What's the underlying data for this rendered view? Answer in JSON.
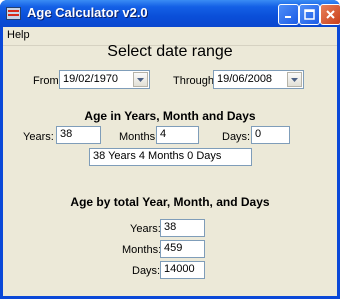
{
  "window": {
    "title": "Age Calculator v2.0"
  },
  "menu": {
    "help": "Help"
  },
  "header": {
    "title": "Select date range"
  },
  "from": {
    "label": "From:",
    "value": "19/02/1970"
  },
  "through": {
    "label": "Through:",
    "value": "19/06/2008"
  },
  "section1": {
    "title": "Age in Years, Month and Days",
    "years_label": "Years:",
    "years_value": "38",
    "months_label": "Months:",
    "months_value": "4",
    "days_label": "Days:",
    "days_value": "0",
    "summary": "38 Years 4 Months 0 Days"
  },
  "section2": {
    "title": "Age by total Year, Month, and Days",
    "years_label": "Years:",
    "years_value": "38",
    "months_label": "Months:",
    "months_value": "459",
    "days_label": "Days:",
    "days_value": "14000"
  },
  "colors": {
    "titlebar": "#0a4fd9",
    "client": "#ece9d8",
    "field_border": "#7f9db9"
  },
  "icons": [
    "app-icon",
    "minimize-icon",
    "maximize-icon",
    "close-icon",
    "chevron-down-icon"
  ]
}
